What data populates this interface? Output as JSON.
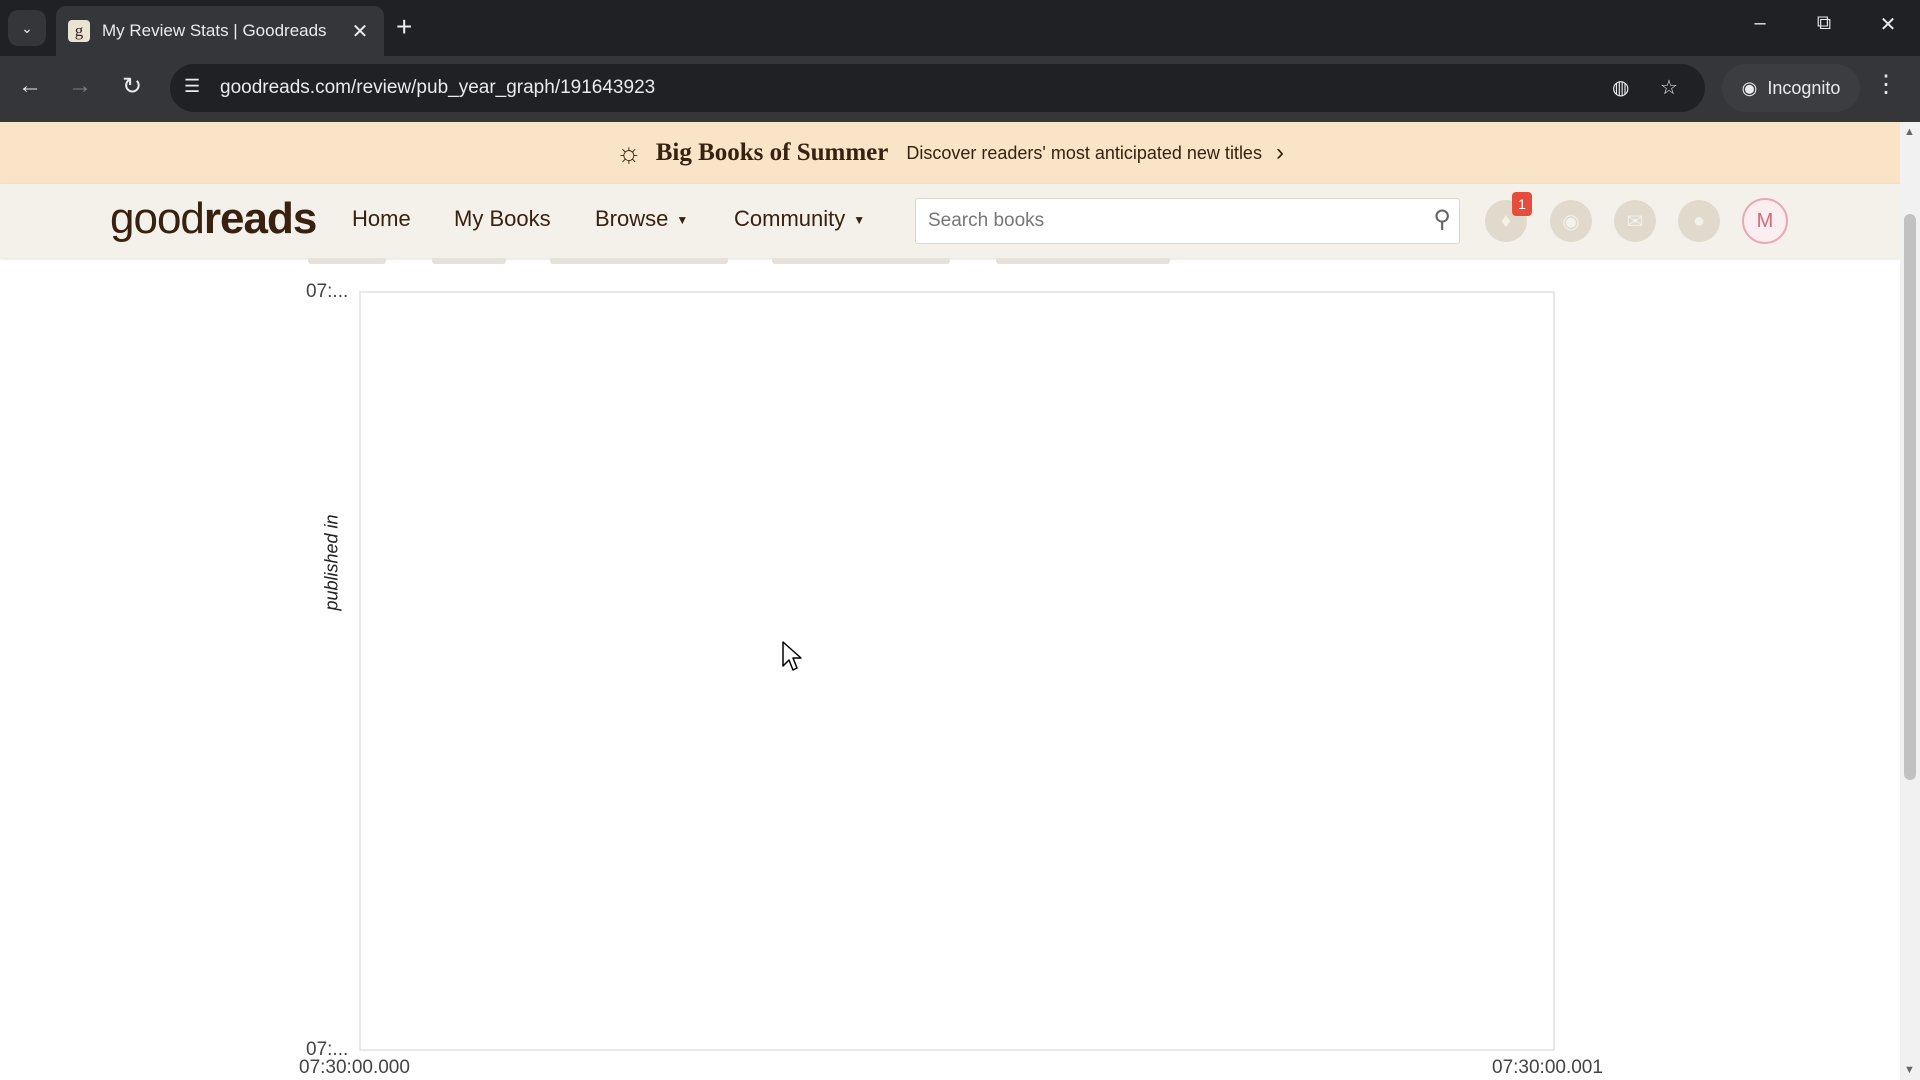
{
  "browser": {
    "tab_title": "My Review Stats | Goodreads",
    "favicon_letter": "g",
    "url": "goodreads.com/review/pub_year_graph/191643923",
    "incognito_label": "Incognito"
  },
  "promo": {
    "title": "Big Books of Summer",
    "text": "Discover readers' most anticipated new titles"
  },
  "header": {
    "logo_light": "good",
    "logo_bold": "reads",
    "nav": {
      "home": "Home",
      "my_books": "My Books",
      "browse": "Browse",
      "community": "Community"
    },
    "search_placeholder": "Search books",
    "notification_count": "1",
    "avatar_letter": "M"
  },
  "chart_data": {
    "type": "scatter",
    "ylabel": "published in",
    "xlabel": "",
    "y_ticks": [
      "07:...",
      "07:..."
    ],
    "x_ticks": [
      "07:30:00.000",
      "07:30:00.001"
    ],
    "series": []
  }
}
